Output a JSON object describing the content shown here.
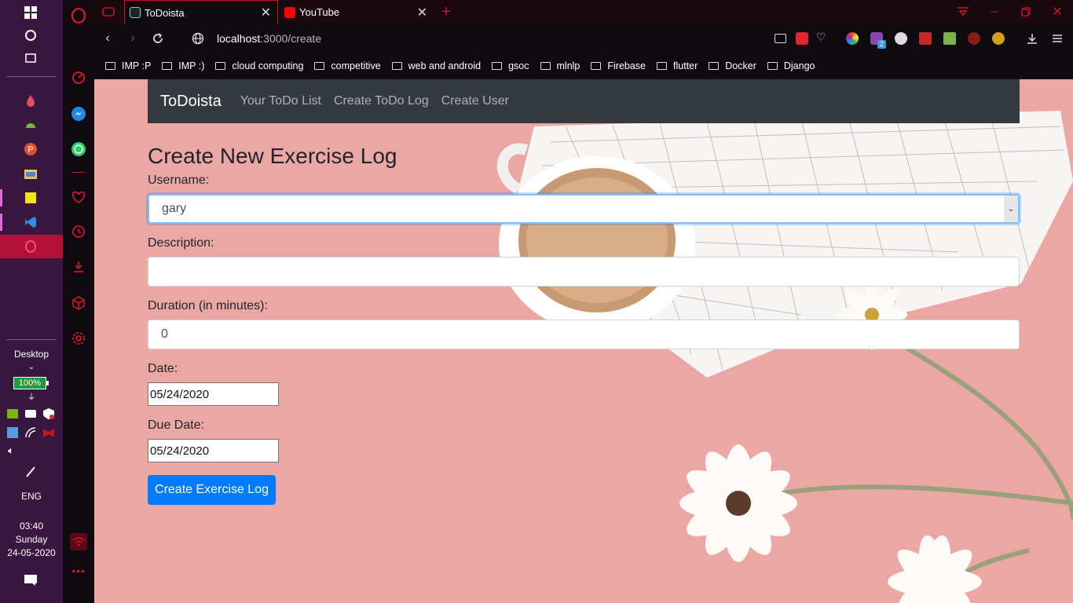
{
  "taskbar": {
    "desktop_label": "Desktop",
    "battery": "100%",
    "language": "ENG",
    "time": "03:40",
    "day": "Sunday",
    "date": "24-05-2020"
  },
  "browser": {
    "tabs": [
      {
        "title": "ToDoista",
        "active": true
      },
      {
        "title": "YouTube",
        "active": false
      }
    ],
    "url_host": "localhost",
    "url_path": ":3000/create",
    "bookmarks": [
      "IMP :P",
      "IMP :)",
      "cloud computing",
      "competitive",
      "web and android",
      "gsoc",
      "mlnlp",
      "Firebase",
      "flutter",
      "Docker",
      "Django"
    ],
    "extension_badge": "2"
  },
  "app": {
    "brand": "ToDoista",
    "nav": [
      "Your ToDo List",
      "Create ToDo Log",
      "Create User"
    ],
    "form": {
      "title": "Create New Exercise Log",
      "username_label": "Username:",
      "username_value": "gary",
      "description_label": "Description:",
      "description_value": "",
      "duration_label": "Duration (in minutes):",
      "duration_value": "0",
      "date_label": "Date:",
      "date_value": "05/24/2020",
      "due_date_label": "Due Date:",
      "due_date_value": "05/24/2020",
      "submit_label": "Create Exercise Log"
    }
  },
  "colors": {
    "accent": "#007bff",
    "navbar": "#343a40",
    "opera_red": "#d01330",
    "page_bg": "#eaa7a4"
  }
}
